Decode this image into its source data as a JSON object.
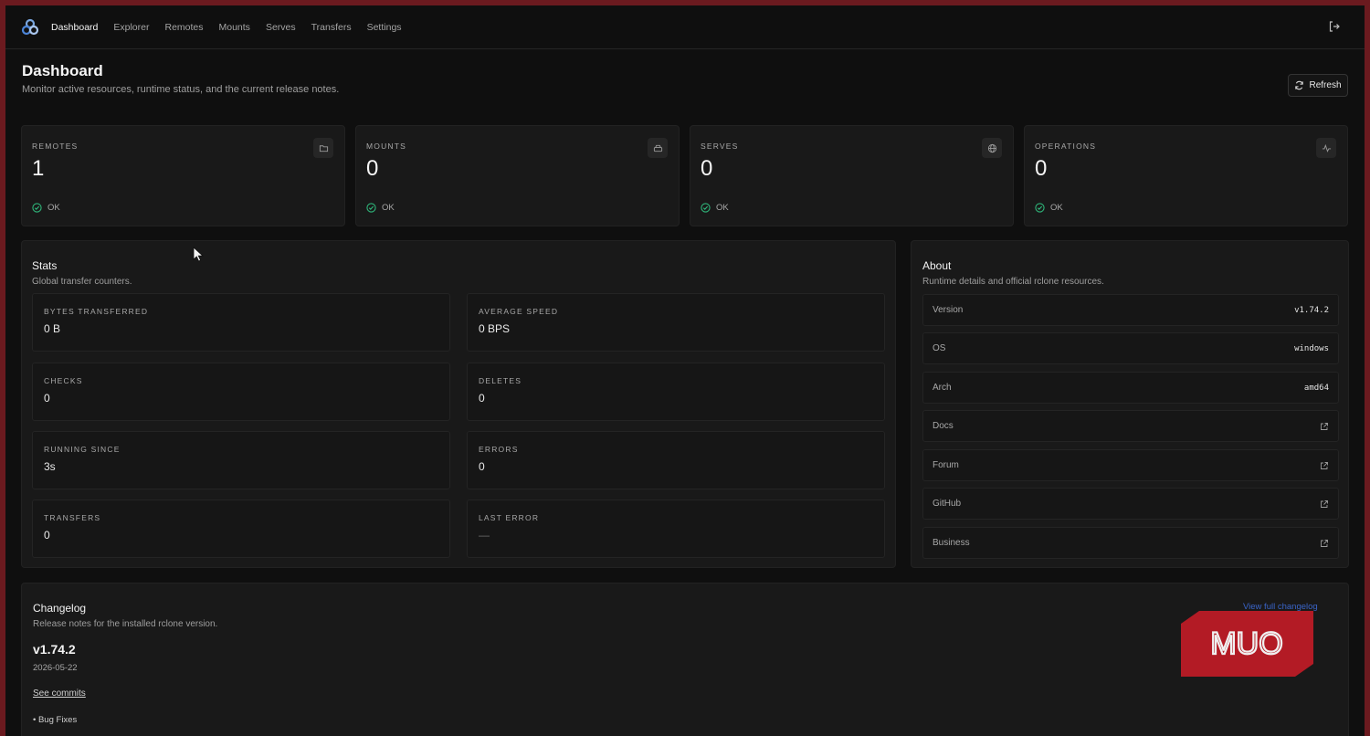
{
  "nav": {
    "items": [
      {
        "label": "Dashboard",
        "active": true
      },
      {
        "label": "Explorer"
      },
      {
        "label": "Remotes"
      },
      {
        "label": "Mounts"
      },
      {
        "label": "Serves"
      },
      {
        "label": "Transfers"
      },
      {
        "label": "Settings"
      }
    ]
  },
  "header": {
    "title": "Dashboard",
    "subtitle": "Monitor active resources, runtime status, and the current release notes.",
    "refresh_label": "Refresh"
  },
  "cards": [
    {
      "label": "REMOTES",
      "value": "1",
      "status": "OK",
      "icon": "folder-icon"
    },
    {
      "label": "MOUNTS",
      "value": "0",
      "status": "OK",
      "icon": "drive-icon"
    },
    {
      "label": "SERVES",
      "value": "0",
      "status": "OK",
      "icon": "globe-icon"
    },
    {
      "label": "OPERATIONS",
      "value": "0",
      "status": "OK",
      "icon": "activity-icon"
    }
  ],
  "stats": {
    "title": "Stats",
    "subtitle": "Global transfer counters.",
    "items": [
      {
        "label": "BYTES TRANSFERRED",
        "value": "0 B"
      },
      {
        "label": "AVERAGE SPEED",
        "value": "0 BPS"
      },
      {
        "label": "CHECKS",
        "value": "0"
      },
      {
        "label": "DELETES",
        "value": "0"
      },
      {
        "label": "RUNNING SINCE",
        "value": "3s"
      },
      {
        "label": "ERRORS",
        "value": "0"
      },
      {
        "label": "TRANSFERS",
        "value": "0"
      },
      {
        "label": "LAST ERROR",
        "value": "—"
      }
    ]
  },
  "about": {
    "title": "About",
    "subtitle": "Runtime details and official rclone resources.",
    "rows": [
      {
        "key": "Version",
        "value": "v1.74.2"
      },
      {
        "key": "OS",
        "value": "windows"
      },
      {
        "key": "Arch",
        "value": "amd64"
      }
    ],
    "links": [
      {
        "label": "Docs"
      },
      {
        "label": "Forum"
      },
      {
        "label": "GitHub"
      },
      {
        "label": "Business"
      }
    ]
  },
  "changelog": {
    "title": "Changelog",
    "subtitle": "Release notes for the installed rclone version.",
    "link_label": "View full changelog",
    "version": "v1.74.2",
    "date": "2026-05-22",
    "commits_label": "See commits",
    "bullet": "Bug Fixes"
  },
  "watermark": {
    "text": "MUO"
  },
  "colors": {
    "ok": "#2fb67a",
    "accent": "#3a64c8",
    "background": "#0f0f0f",
    "card": "#191919"
  }
}
